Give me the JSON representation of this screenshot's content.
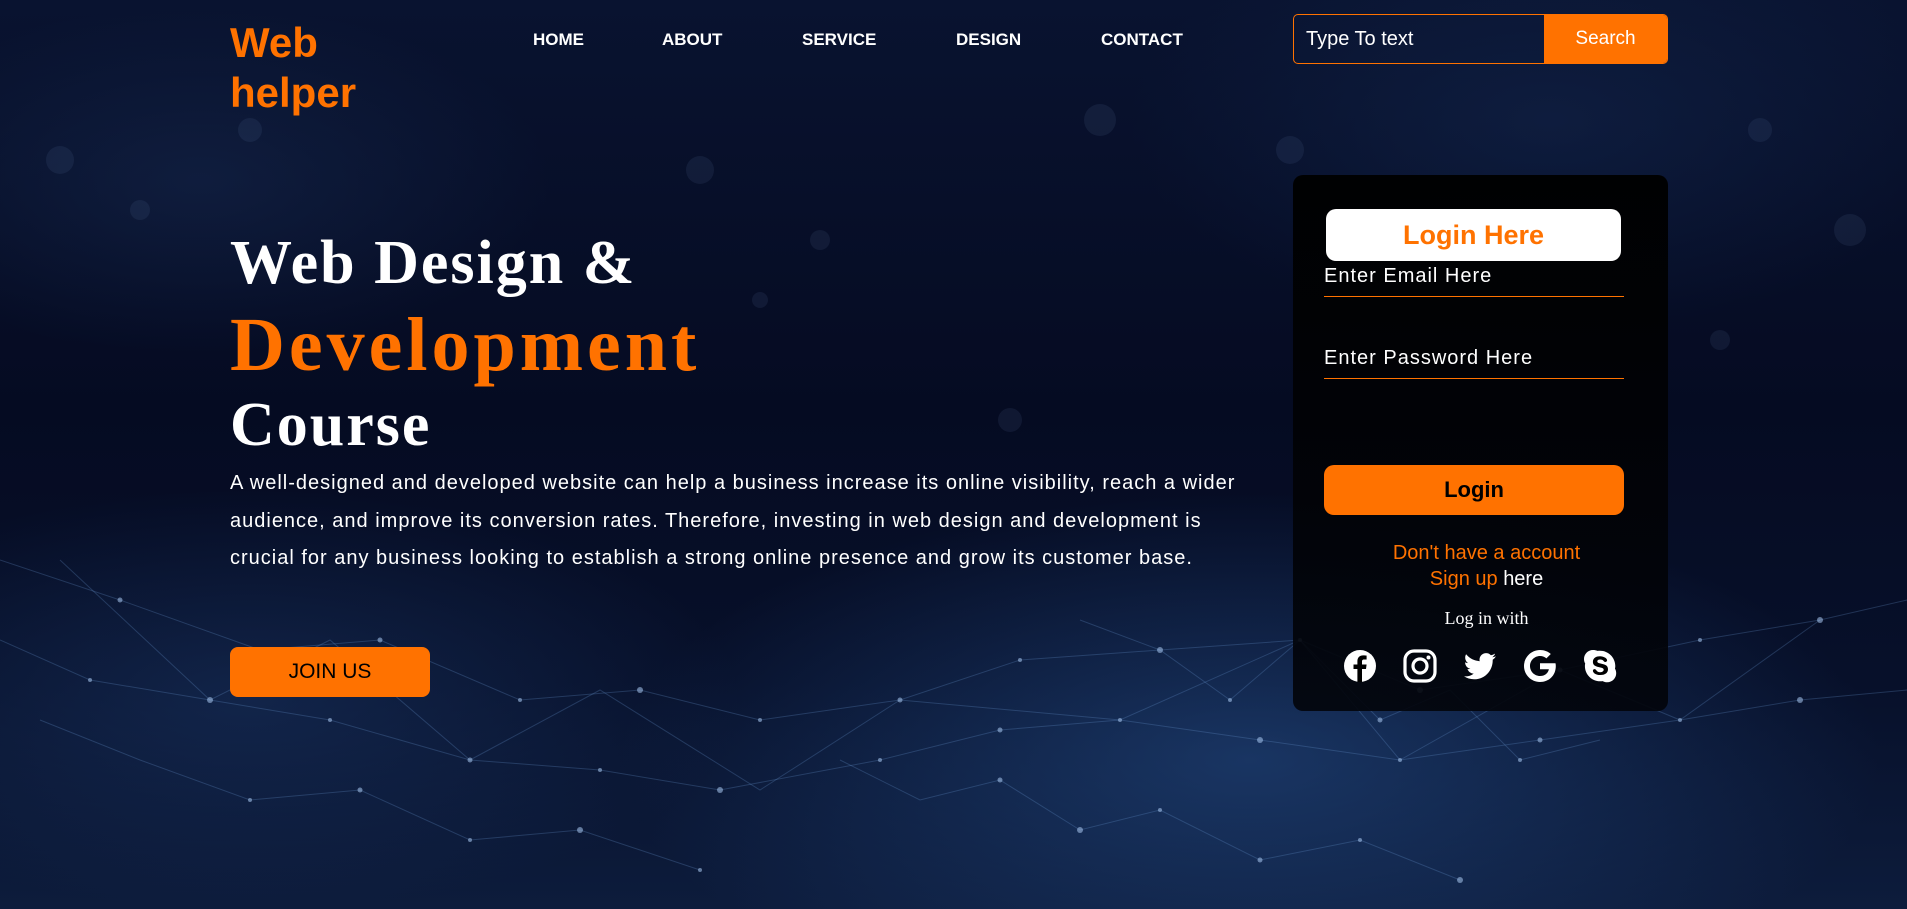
{
  "brand": {
    "line1": "Web",
    "line2": "helper"
  },
  "nav": [
    {
      "label": "HOME"
    },
    {
      "label": "ABOUT"
    },
    {
      "label": "SERVICE"
    },
    {
      "label": "DESIGN"
    },
    {
      "label": "CONTACT"
    }
  ],
  "search": {
    "placeholder": "Type To text",
    "button_label": "Search"
  },
  "hero": {
    "title_line1": "Web Design &",
    "title_line2": "Development",
    "title_line3": "Course",
    "description": "A well-designed and developed website can help a business increase its online visibility, reach a wider audience, and improve its conversion rates. Therefore, investing in web design and development is crucial for any business looking to establish a strong online presence and grow its customer base.",
    "cta_label": "JOIN US"
  },
  "login": {
    "title": "Login Here",
    "email_placeholder": "Enter Email Here",
    "password_placeholder": "Enter Password Here",
    "button_label": "Login",
    "no_account_text": "Don't have a account",
    "signup_link": "Sign up",
    "signup_suffix": "here",
    "login_with": "Log in with",
    "socials": [
      {
        "icon": "facebook-icon"
      },
      {
        "icon": "instagram-icon"
      },
      {
        "icon": "twitter-icon"
      },
      {
        "icon": "google-icon"
      },
      {
        "icon": "skype-icon"
      }
    ]
  },
  "colors": {
    "accent": "#ff7200",
    "background": "#050b1e",
    "card": "#000000",
    "text": "#ffffff"
  }
}
